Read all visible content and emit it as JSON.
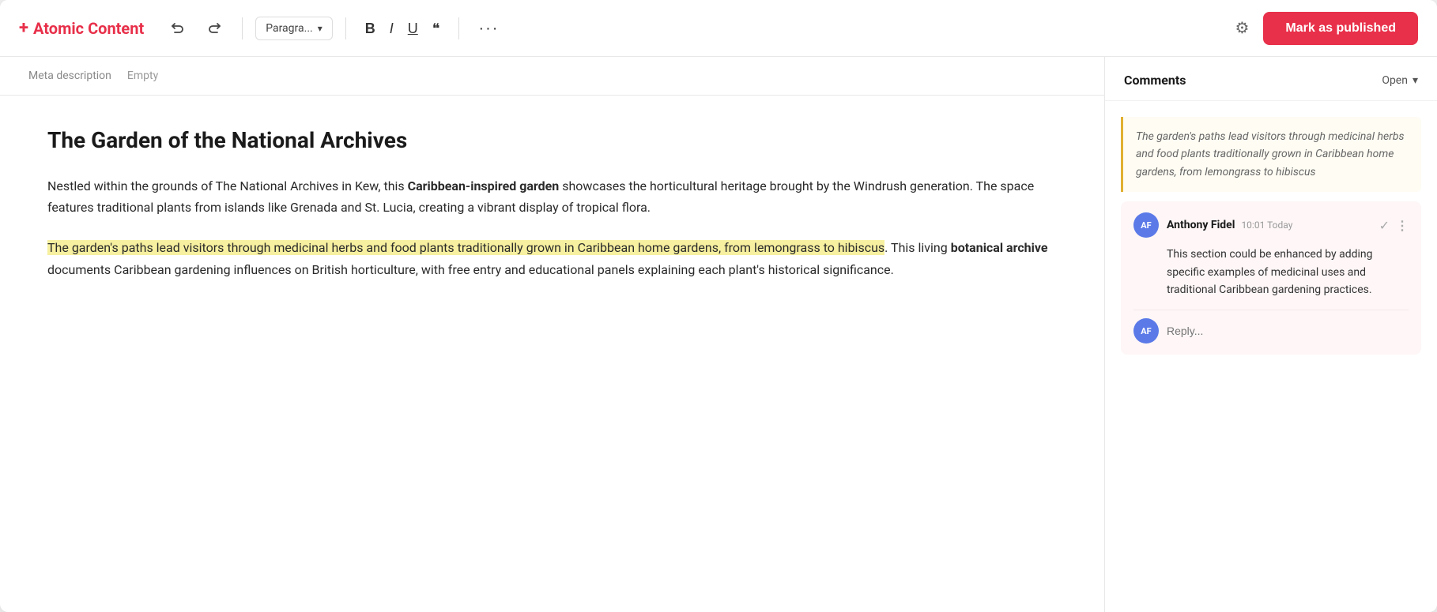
{
  "app": {
    "brand": "Atomic Content",
    "brand_plus": "+"
  },
  "toolbar": {
    "undo_label": "↩",
    "redo_label": "↪",
    "paragraph_label": "Paragra...",
    "bold_label": "B",
    "italic_label": "I",
    "underline_label": "U",
    "quote_label": "❝",
    "more_label": "···",
    "gear_label": "⚙",
    "publish_label": "Mark as published"
  },
  "meta": {
    "label": "Meta description",
    "value": "Empty"
  },
  "editor": {
    "heading": "The Garden of the National Archives",
    "paragraph1": "Nestled within the grounds of The National Archives in Kew, this ",
    "paragraph1_bold": "Caribbean-inspired garden",
    "paragraph1_rest": " showcases the horticultural heritage brought by the Windrush generation. The space features traditional plants from islands like Grenada and St. Lucia, creating a vibrant display of tropical flora.",
    "paragraph2_highlight": "The garden's paths lead visitors through medicinal herbs and food plants traditionally grown in Caribbean home gardens, from lemongrass to hibiscus",
    "paragraph2_rest": ". This living ",
    "paragraph2_bold": "botanical archive",
    "paragraph2_end": " documents Caribbean gardening influences on British horticulture, with free entry and educational panels explaining each plant's historical significance."
  },
  "comments": {
    "title": "Comments",
    "status": "Open",
    "chevron": "▾",
    "highlight_quote": "The garden's paths lead visitors through medicinal herbs and food plants traditionally grown in Caribbean home gardens, from lemongrass to hibiscus",
    "thread": {
      "author_initials": "AF",
      "author_name": "Anthony Fidel",
      "time": "10:01 Today",
      "body": "This section could be enhanced by adding specific examples of medicinal uses and traditional Caribbean gardening practices.",
      "reply_placeholder": "Reply..."
    }
  }
}
